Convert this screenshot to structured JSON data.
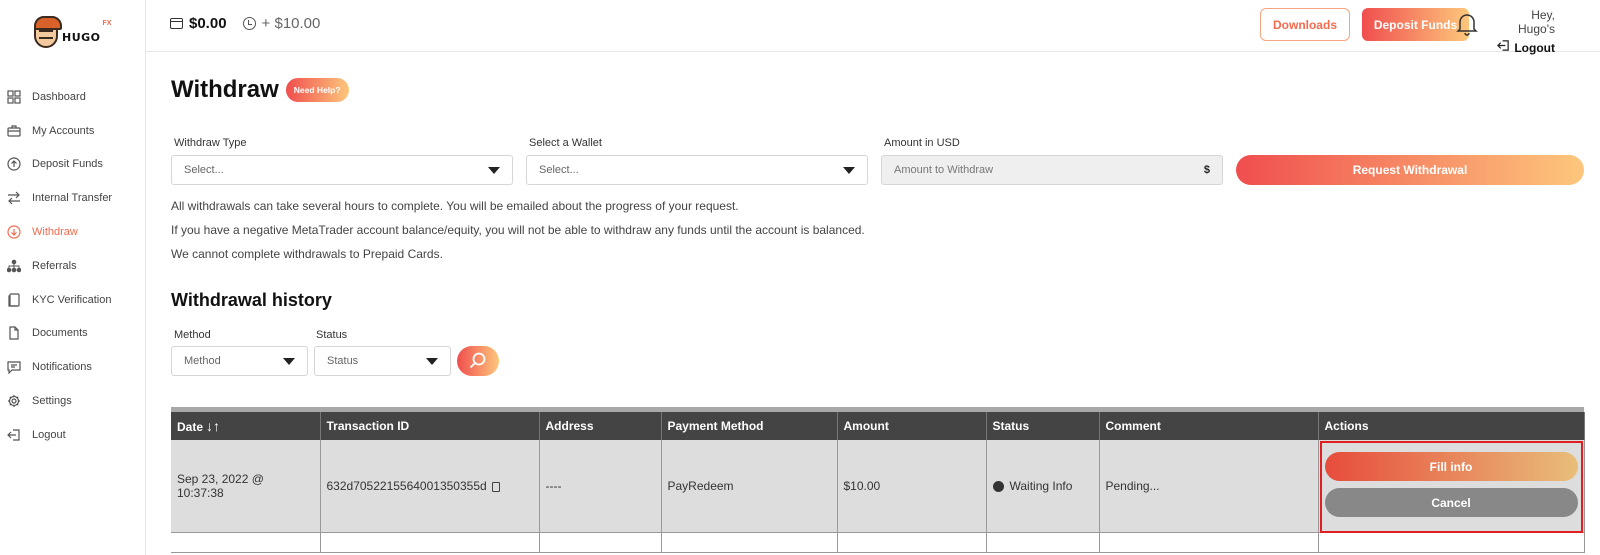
{
  "brand": {
    "name": "HUGO",
    "suffix": "FX"
  },
  "topbar": {
    "balance": "$0.00",
    "pending": "+ $10.00",
    "downloads_label": "Downloads",
    "deposit_label": "Deposit Funds",
    "greeting": "Hey, Hugo's",
    "logout_label": "Logout"
  },
  "sidebar": {
    "items": [
      {
        "label": "Dashboard",
        "icon": "grid-icon"
      },
      {
        "label": "My Accounts",
        "icon": "briefcase-icon"
      },
      {
        "label": "Deposit Funds",
        "icon": "arrow-up-circle-icon"
      },
      {
        "label": "Internal Transfer",
        "icon": "transfer-icon"
      },
      {
        "label": "Withdraw",
        "icon": "arrow-down-circle-icon",
        "active": true
      },
      {
        "label": "Referrals",
        "icon": "hierarchy-icon"
      },
      {
        "label": "KYC Verification",
        "icon": "id-card-icon"
      },
      {
        "label": "Documents",
        "icon": "document-icon"
      },
      {
        "label": "Notifications",
        "icon": "message-icon"
      },
      {
        "label": "Settings",
        "icon": "gear-icon"
      },
      {
        "label": "Logout",
        "icon": "logout-icon"
      }
    ]
  },
  "page": {
    "title": "Withdraw",
    "help_badge": "Need Help?"
  },
  "form": {
    "withdraw_type_label": "Withdraw Type",
    "withdraw_type_value": "Select...",
    "wallet_label": "Select a Wallet",
    "wallet_value": "Select...",
    "amount_label": "Amount in USD",
    "amount_placeholder": "Amount to Withdraw",
    "amount_currency": "$",
    "request_label": "Request Withdrawal"
  },
  "notes": [
    "All withdrawals can take several hours to complete. You will be emailed about the progress of your request.",
    "If you have a negative MetaTrader account balance/equity, you will not be able to withdraw any funds until the account is balanced.",
    "We cannot complete withdrawals to Prepaid Cards."
  ],
  "history": {
    "title": "Withdrawal history",
    "method_label": "Method",
    "method_value": "Method",
    "status_label": "Status",
    "status_value": "Status"
  },
  "table": {
    "headers": [
      "Date",
      "Transaction ID",
      "Address",
      "Payment Method",
      "Amount",
      "Status",
      "Comment",
      "Actions"
    ],
    "sort_arrows": "↓↑",
    "rows": [
      {
        "date": "Sep 23, 2022 @ 10:37:38",
        "transaction_id": "632d7052215564001350355d",
        "address": "----",
        "payment_method": "PayRedeem",
        "amount": "$10.00",
        "status": "Waiting Info",
        "comment": "Pending...",
        "fill_label": "Fill info",
        "cancel_label": "Cancel"
      }
    ]
  },
  "colors": {
    "accent": "#f26b4f",
    "gradient_start": "#f04e4e",
    "gradient_end": "#fdc77c",
    "table_header": "#444444",
    "highlight_border": "#e02020"
  }
}
